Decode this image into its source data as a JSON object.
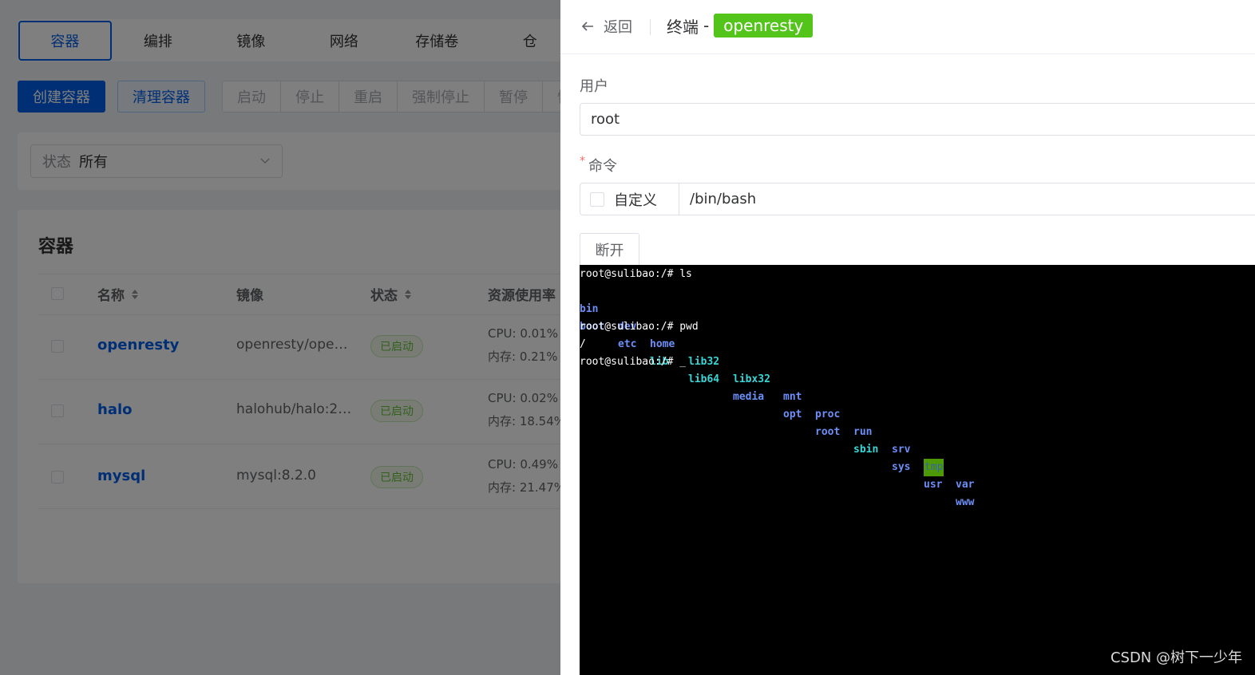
{
  "nav_tabs": [
    "容器",
    "编排",
    "镜像",
    "网络",
    "存储卷",
    "仓"
  ],
  "toolbar": {
    "create": "创建容器",
    "clean": "清理容器",
    "group": [
      "启动",
      "停止",
      "重启",
      "强制停止",
      "暂停",
      "恢"
    ]
  },
  "filter": {
    "label": "状态",
    "value": "所有"
  },
  "list": {
    "title": "容器",
    "headers": {
      "name": "名称",
      "image": "镜像",
      "status": "状态",
      "resource": "资源使用率"
    },
    "rows": [
      {
        "name": "openresty",
        "image": "openresty/ope…",
        "status": "已启动",
        "cpu": "CPU: 0.01%",
        "mem": "内存: 0.21%"
      },
      {
        "name": "halo",
        "image": "halohub/halo:2…",
        "status": "已启动",
        "cpu": "CPU: 0.02%",
        "mem": "内存: 18.54%"
      },
      {
        "name": "mysql",
        "image": "mysql:8.2.0",
        "status": "已启动",
        "cpu": "CPU: 0.49%",
        "mem": "内存: 21.47%"
      }
    ]
  },
  "drawer": {
    "back": "返回",
    "title": "终端",
    "title_sep": "-",
    "container_name": "openresty",
    "user_label": "用户",
    "user_value": "root",
    "command_label": "命令",
    "custom_label": "自定义",
    "command_value": "/bin/bash",
    "disconnect": "断开"
  },
  "terminal": {
    "line1": "root@sulibao:/# ls",
    "row1": [
      "bin",
      "dev",
      "home",
      "lib32",
      "libx32",
      "mnt",
      "proc",
      "run",
      "srv",
      "tmp",
      "var"
    ],
    "row2": [
      "boot",
      "etc",
      "lib",
      "lib64",
      "media",
      "opt",
      "root",
      "sbin",
      "sys",
      "usr",
      "www"
    ],
    "line4": "root@sulibao:/# pwd",
    "line5": "/",
    "line6": "root@sulibao:/# _"
  },
  "watermark": "CSDN @树下一少年",
  "colors": {
    "primary": "#005eeb",
    "success": "#52c41a",
    "terminal_bg": "#000000"
  },
  "icons": {
    "back": "arrow-left-icon",
    "select": "chevron-down-icon",
    "sort": "sort-icon"
  }
}
